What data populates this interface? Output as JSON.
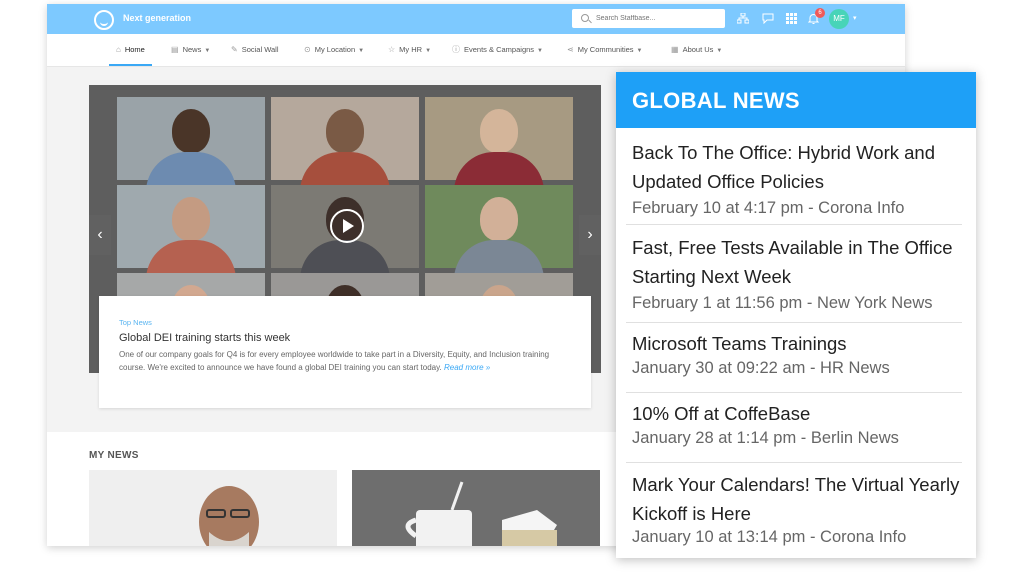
{
  "topbar": {
    "brand": "Next generation",
    "search_placeholder": "Search Staffbase...",
    "icons": [
      "org-chart-icon",
      "chat-icon",
      "apps-grid-icon",
      "bell-icon"
    ],
    "notification_count": "6",
    "avatar_initials": "MF",
    "accent_color": "#7dc9ff"
  },
  "nav": {
    "items": [
      {
        "label": "Home",
        "icon": "home-icon",
        "active": true
      },
      {
        "label": "News",
        "icon": "news-icon",
        "dropdown": true
      },
      {
        "label": "Social Wall",
        "icon": "edit-icon"
      },
      {
        "label": "My Location",
        "icon": "location-icon",
        "dropdown": true
      },
      {
        "label": "My HR",
        "icon": "star-icon",
        "dropdown": true
      },
      {
        "label": "Events & Campaigns",
        "icon": "info-icon",
        "dropdown": true
      },
      {
        "label": "My Communities",
        "icon": "share-icon",
        "dropdown": true
      },
      {
        "label": "About Us",
        "icon": "building-icon",
        "dropdown": true
      }
    ]
  },
  "featured": {
    "kicker": "Top News",
    "title": "Global DEI training starts this week",
    "body": "One of our company goals for Q4 is for every employee worldwide to take part in a Diversity, Equity, and Inclusion training course. We're excited to announce we have found a global DEI training you can start today.",
    "read_more": "Read more »"
  },
  "my_news": {
    "label": "MY NEWS"
  },
  "global_news": {
    "title": "GLOBAL NEWS",
    "header_color": "#1ea0f7",
    "items": [
      {
        "title": "Back To The Office: Hybrid Work and Updated Office Policies",
        "meta": "February 10 at 4:17 pm - Corona Info"
      },
      {
        "title": "Fast, Free Tests Available in The Office Starting Next Week",
        "meta": "February 1 at 11:56 pm - New York News"
      },
      {
        "title": "Microsoft Teams Trainings",
        "meta": "January 30 at 09:22 am - HR News"
      },
      {
        "title": "10% Off at CoffeBase",
        "meta": "January 28 at 1:14 pm - Berlin News"
      },
      {
        "title": "Mark Your Calendars! The Virtual Yearly Kickoff is Here",
        "meta": "January 10 at 13:14 pm - Corona Info"
      }
    ]
  }
}
